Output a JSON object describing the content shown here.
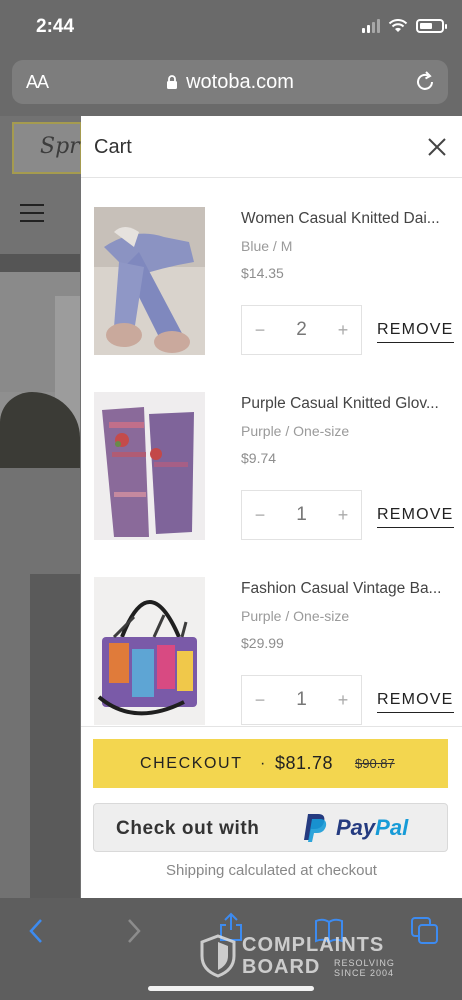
{
  "status_bar": {
    "time": "2:44"
  },
  "browser": {
    "aa_label": "AA",
    "url": "wotoba.com"
  },
  "cart": {
    "title": "Cart",
    "items": [
      {
        "title": "Women Casual Knitted Dai...",
        "variant": "Blue / M",
        "price": "$14.35",
        "quantity": "2",
        "remove_label": "REMOVE"
      },
      {
        "title": "Purple Casual Knitted Glov...",
        "variant": "Purple / One-size",
        "price": "$9.74",
        "quantity": "1",
        "remove_label": "REMOVE"
      },
      {
        "title": "Fashion Casual Vintage Ba...",
        "variant": "Purple / One-size",
        "price": "$29.99",
        "quantity": "1",
        "remove_label": "REMOVE"
      }
    ],
    "checkout": {
      "label": "CHECKOUT",
      "separator": "·",
      "total": "$81.78",
      "original_total": "$90.87"
    },
    "paypal": {
      "prefix": "Check out with",
      "brand_a": "Pay",
      "brand_b": "Pal"
    },
    "shipping_note": "Shipping calculated at checkout"
  },
  "watermark": {
    "line1": "COMPLAINTS",
    "line2": "BOARD",
    "line3": "RESOLVING SINCE 2004"
  },
  "colors": {
    "checkout_bg": "#f3d64f",
    "paypal_dark": "#253b80",
    "paypal_light": "#179bd7"
  },
  "icons": {
    "close": "close-icon",
    "back": "back-arrow-icon",
    "forward": "forward-arrow-icon",
    "share": "share-icon",
    "bookmarks": "book-icon",
    "tabs": "tabs-icon"
  }
}
